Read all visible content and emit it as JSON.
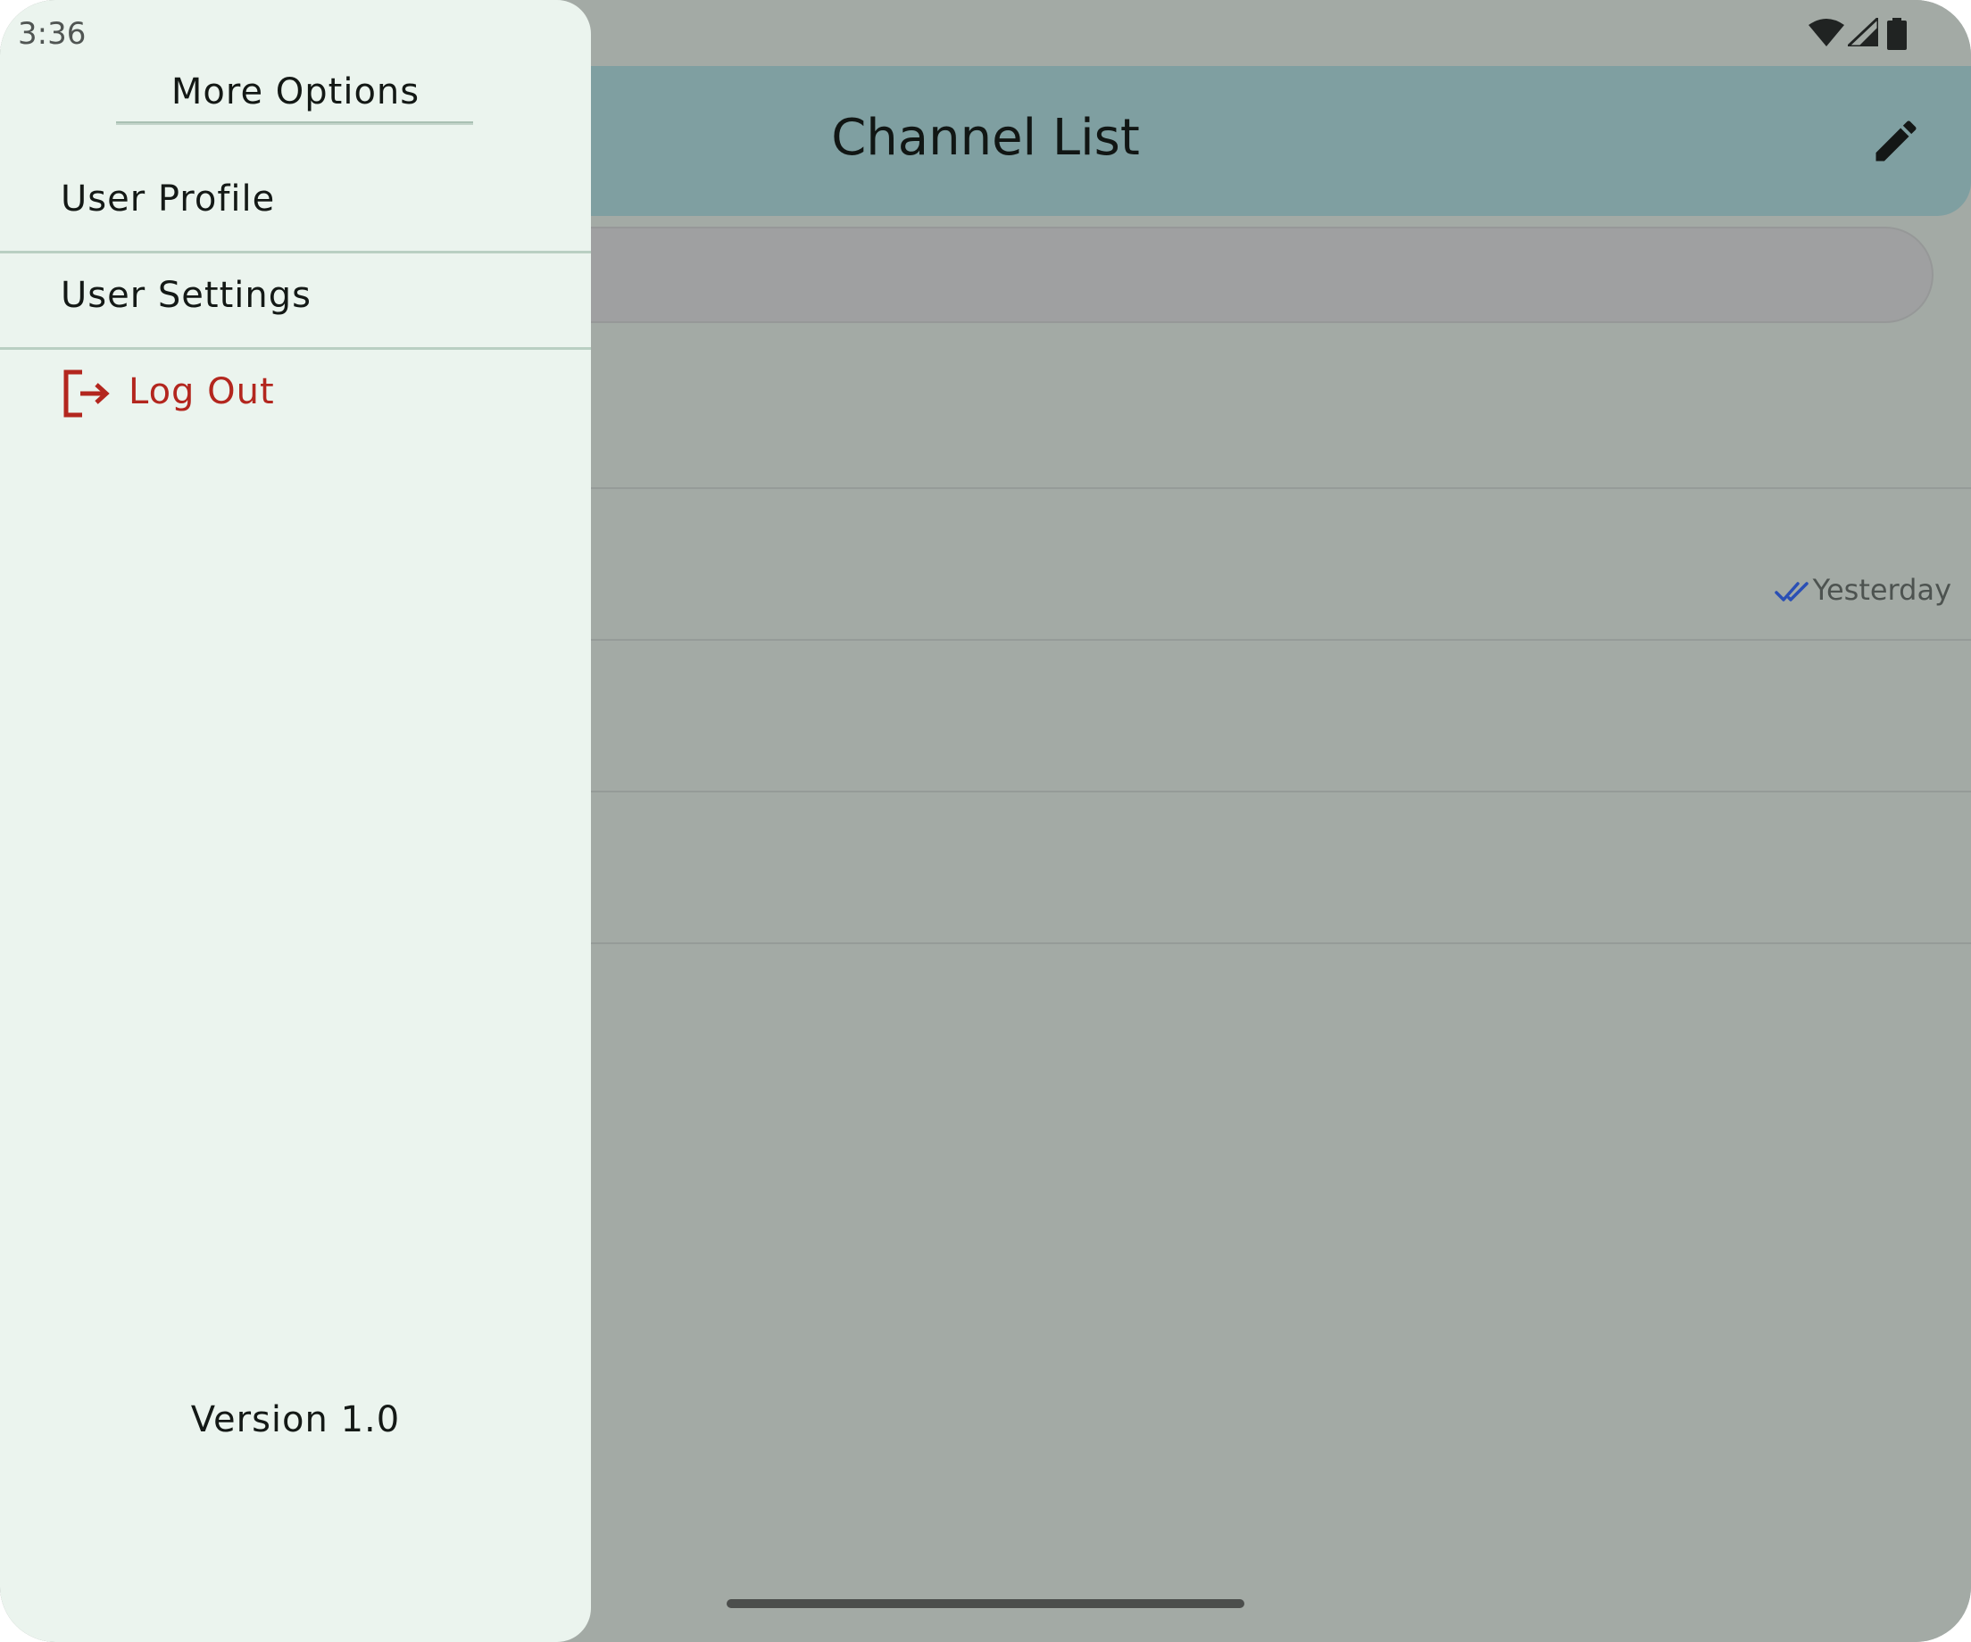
{
  "status_bar": {
    "time": "3:36",
    "icons": [
      "wifi-icon",
      "cellular-signal-icon",
      "battery-icon"
    ]
  },
  "app_bar": {
    "title": "Channel List",
    "action_icon": "edit-pencil-icon"
  },
  "channel_list": {
    "rows": [
      {
        "timestamp": ""
      },
      {
        "timestamp": "Yesterday",
        "read_status_icon": "double-check-icon"
      },
      {
        "timestamp": ""
      },
      {
        "timestamp": ""
      }
    ]
  },
  "drawer": {
    "title": "More Options",
    "items": [
      {
        "label": "User Profile"
      },
      {
        "label": "User Settings"
      },
      {
        "label": "Log Out",
        "icon": "logout-icon"
      }
    ],
    "version": "Version 1.0"
  },
  "colors": {
    "drawer_background": "#ebf4ee",
    "scrim": "#a3aaa5",
    "app_bar": "#7f9fa1",
    "logout_red": "#b3261e",
    "read_check_blue": "#2a4fb5"
  }
}
